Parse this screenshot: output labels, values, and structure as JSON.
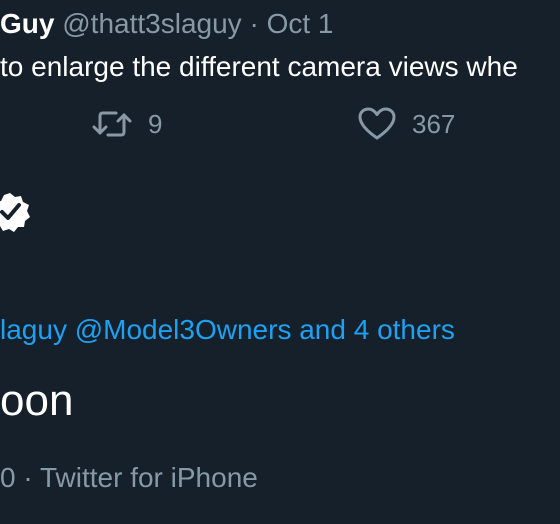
{
  "tweet": {
    "author_name": "Guy",
    "handle": "@thatt3slaguy",
    "separator": "·",
    "date": "Oct 1",
    "text": "to enlarge the different camera views whe",
    "actions": {
      "retweet_count": "9",
      "like_count": "367"
    }
  },
  "reply": {
    "replying_text": "laguy @Model3Owners and 4 others",
    "body_fragment": "oon",
    "meta": {
      "time_fragment": "0",
      "separator": "·",
      "source": "Twitter for iPhone"
    }
  },
  "colors": {
    "background": "#15202b",
    "text_primary": "#ffffff",
    "text_secondary": "#8899a6",
    "accent": "#1da1f2"
  },
  "icons": {
    "retweet": "retweet-icon",
    "like": "heart-icon",
    "verified": "verified-badge-icon"
  }
}
